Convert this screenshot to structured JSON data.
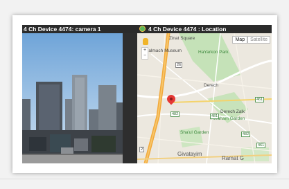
{
  "camera_pane": {
    "title": "4 Ch Device 4474: camera 1"
  },
  "map_pane": {
    "title": "4 Ch Device 4474 : Location",
    "map_type_buttons": [
      "Map",
      "Satellite"
    ],
    "zoom": {
      "in": "+",
      "out": "−"
    },
    "labels": {
      "zina_square": "Zinat Square",
      "palmach_museum": "Palmach Museum",
      "hayarkon_park": "HaYarkon Park",
      "avraham_garden": "Avraham Garden",
      "shalul_garden": "Sha'ul Garden",
      "givatayim": "Givatayim",
      "ramat_g": "Ramat G",
      "derech_rd1": "Derech",
      "derech_rd2": "Derech Zalk"
    },
    "route_shields": [
      "26",
      "482",
      "481",
      "461",
      "482",
      "461",
      "2"
    ]
  },
  "colors": {
    "title_bar": "#2b2b2b",
    "highway": "#f2a93b",
    "park": "#bfe0b3",
    "pin": "#e53935"
  }
}
